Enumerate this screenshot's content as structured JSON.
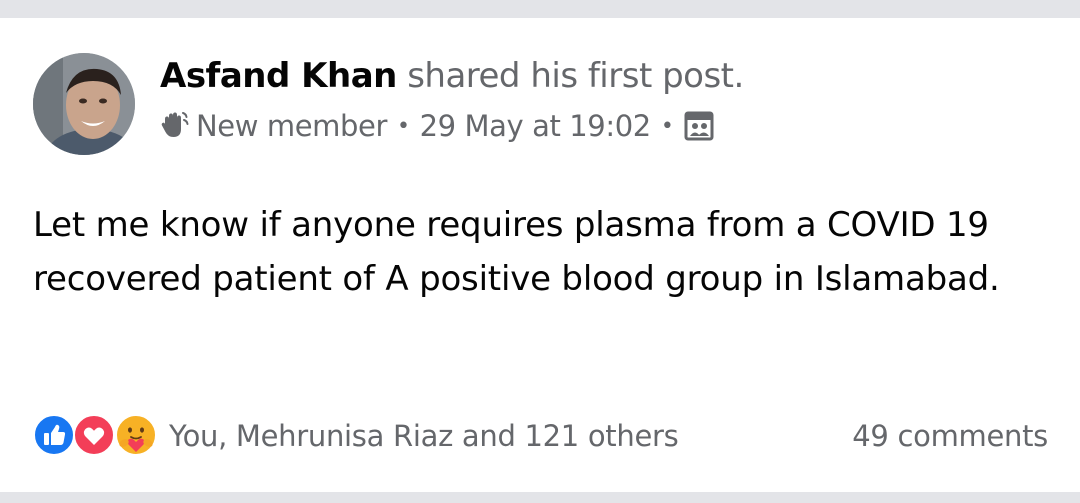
{
  "post": {
    "author": "Asfand Khan",
    "action_text": "shared his first post.",
    "badge_text": "New member",
    "timestamp": "29 May at 19:02",
    "body": "Let me know if anyone requires plasma from a COVID 19 recovered patient of A positive blood group in Islamabad."
  },
  "footer": {
    "reactions_text": "You, Mehrunisa Riaz and 121 others",
    "comments_text": "49 comments",
    "reaction_icons": [
      "like-icon",
      "love-icon",
      "care-icon"
    ]
  },
  "colors": {
    "like": "#1877f2",
    "love": "#f33e58",
    "care": "#f7b125",
    "secondary_text": "#65676b",
    "separator": "#e3e4e8"
  }
}
